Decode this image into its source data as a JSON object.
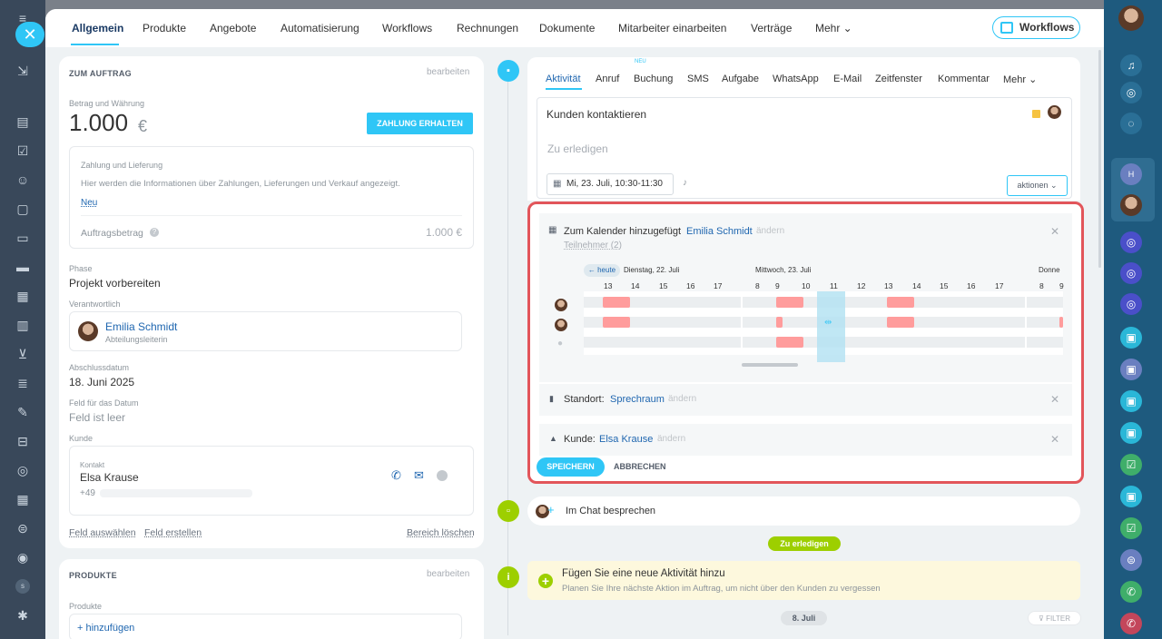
{
  "topnav": {
    "tabs": [
      "Allgemein",
      "Produkte",
      "Angebote",
      "Automatisierung",
      "Workflows",
      "Rechnungen",
      "Dokumente",
      "Mitarbeiter einarbeiten",
      "Verträge",
      "Mehr"
    ],
    "workflows_button": "Workflows"
  },
  "order": {
    "section_title": "ZUM AUFTRAG",
    "edit": "bearbeiten",
    "amount_label": "Betrag und Währung",
    "amount": "1.000",
    "currency": "€",
    "pay_button": "ZAHLUNG ERHALTEN",
    "payment_title": "Zahlung und Lieferung",
    "payment_info": "Hier werden die Informationen über Zahlungen, Lieferungen und Verkauf angezeigt.",
    "new_link": "Neu",
    "order_amount_label": "Auftragsbetrag",
    "order_amount_value": "1.000 €",
    "phase_label": "Phase",
    "phase_value": "Projekt vorbereiten",
    "responsible_label": "Verantwortlich",
    "responsible_name": "Emilia Schmidt",
    "responsible_role": "Abteilungsleiterin",
    "close_date_label": "Abschlussdatum",
    "close_date_value": "18. Juni 2025",
    "date_field_label": "Feld für das Datum",
    "date_field_value": "Feld ist leer",
    "customer_label": "Kunde",
    "contact_label": "Kontakt",
    "contact_name": "Elsa Krause",
    "contact_phone": "+49",
    "select_field": "Feld auswählen",
    "create_field": "Feld erstellen",
    "delete_section": "Bereich löschen"
  },
  "products": {
    "section_title": "PRODUKTE",
    "edit": "bearbeiten",
    "label": "Produkte",
    "add": "+ hinzufügen"
  },
  "activity": {
    "tabs": [
      "Aktivität",
      "Anruf",
      "Buchung",
      "SMS",
      "Aufgabe",
      "WhatsApp",
      "E-Mail",
      "Zeitfenster",
      "Kommentar",
      "Mehr"
    ],
    "new_badge": "NEU",
    "task_title": "Kunden kontaktieren",
    "task_placeholder": "Zu erledigen",
    "task_date": "Mi, 23. Juli, 10:30-11:30",
    "actions_button": "aktionen",
    "calendar_added": "Zum Kalender hinzugefügt",
    "calendar_person": "Emilia Schmidt",
    "change": "ändern",
    "participants": "Teilnehmer (2)",
    "today": "← heute",
    "day1": "Dienstag, 22. Juli",
    "day2": "Mittwoch, 23. Juli",
    "day3": "Donne",
    "hours1": [
      "13",
      "14",
      "15",
      "16",
      "17"
    ],
    "hours2": [
      "8",
      "9",
      "10",
      "11",
      "12",
      "13",
      "14",
      "15",
      "16",
      "17"
    ],
    "hours3": [
      "8",
      "9"
    ],
    "location_label": "Standort:",
    "location_value": "Sprechraum",
    "customer_label": "Kunde:",
    "customer_value": "Elsa Krause",
    "save": "SPEICHERN",
    "cancel": "ABBRECHEN",
    "chat": "Im Chat besprechen",
    "todo_badge": "Zu erledigen",
    "add_activity_title": "Fügen Sie eine neue Aktivität hinzu",
    "add_activity_hint": "Planen Sie Ihre nächste Aktion im Auftrag, um nicht über den Kunden zu vergessen",
    "date_pill": "8. Juli",
    "filter": "FILTER"
  },
  "colors": {
    "accent": "#2fc6f6",
    "highlight": "#e2555a",
    "busy": "#ff9c9c",
    "green": "#9dcf00"
  }
}
